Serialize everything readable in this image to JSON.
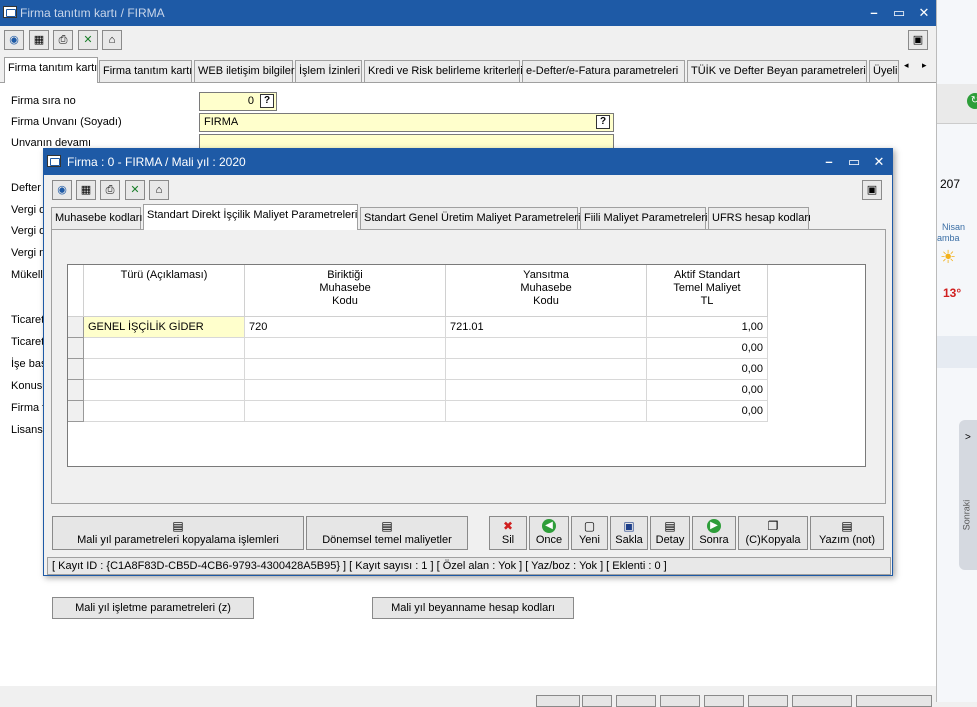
{
  "window": {
    "title": "Firma tanıtım kartı / FIRMA"
  },
  "outer_tabs": [
    "Firma tanıtım kartı",
    "Firma tanıtım kartı",
    "WEB iletişim bilgileri",
    "İşlem İzinleri",
    "Kredi ve Risk belirleme kriterleri",
    "e-Defter/e-Fatura parametreleri",
    "TÜİK ve Defter Beyan parametreleri",
    "Üyeli"
  ],
  "form": {
    "sira_label": "Firma sıra no",
    "sira_value": "0",
    "unvan_label": "Firma Unvanı (Soyadı)",
    "unvan_value": "FIRMA",
    "devam_label": "Unvanın devamı",
    "left_labels": [
      "Defter",
      "Vergi d",
      "Vergi d",
      "Vergi n",
      "Mükelle",
      "Ticaret",
      "Ticaret",
      "İşe baş",
      "Konusu",
      "Firma f",
      "Lisans"
    ]
  },
  "right_strip": {
    "number": "207",
    "weather_day": "Nisan",
    "weather_sub": "amba",
    "temp": "13°",
    "sonraki": "Sonraki"
  },
  "outer_buttons": {
    "mali_yil_isletme": "Mali yıl işletme parametreleri (z)",
    "beyanname": "Mali yıl beyanname hesap kodları"
  },
  "inner": {
    "title": "Firma : 0 -  FIRMA / Mali yıl : 2020",
    "tabs": [
      "Muhasebe kodları",
      "Standart Direkt İşçilik Maliyet Parametreleri",
      "Standart Genel Üretim Maliyet Parametreleri",
      "Fiili Maliyet Parametreleri",
      "UFRS hesap kodları"
    ],
    "grid": {
      "headers": [
        "Türü (Açıklaması)",
        "Biriktiği\nMuhasebe\nKodu",
        "Yansıtma\nMuhasebe\nKodu",
        "Aktif Standart\nTemel Maliyet\nTL"
      ],
      "rows": [
        [
          "GENEL İŞÇİLİK GİDER",
          "720",
          "721.01",
          "1,00"
        ],
        [
          "",
          "",
          "",
          "0,00"
        ],
        [
          "",
          "",
          "",
          "0,00"
        ],
        [
          "",
          "",
          "",
          "0,00"
        ],
        [
          "",
          "",
          "",
          "0,00"
        ]
      ]
    },
    "buttons": {
      "kopyalama": "Mali yıl parametreleri kopyalama işlemleri",
      "donemsel": "Dönemsel temel maliyetler",
      "sil": "Sil",
      "once": "Once",
      "yeni": "Yeni",
      "sakla": "Sakla",
      "detay": "Detay",
      "sonra": "Sonra",
      "kopyala": "(C)Kopyala",
      "yazim": "Yazım (not)"
    },
    "status": "[ Kayıt ID : {C1A8F83D-CB5D-4CB6-9793-4300428A5B95} ] [ Kayıt sayısı : 1 ] [ Özel alan : Yok ] [ Yaz/boz : Yok ] [ Eklenti : 0 ]"
  },
  "colors": {
    "titlebar": "#1e5aa6",
    "field_bg": "#ffffcc"
  }
}
